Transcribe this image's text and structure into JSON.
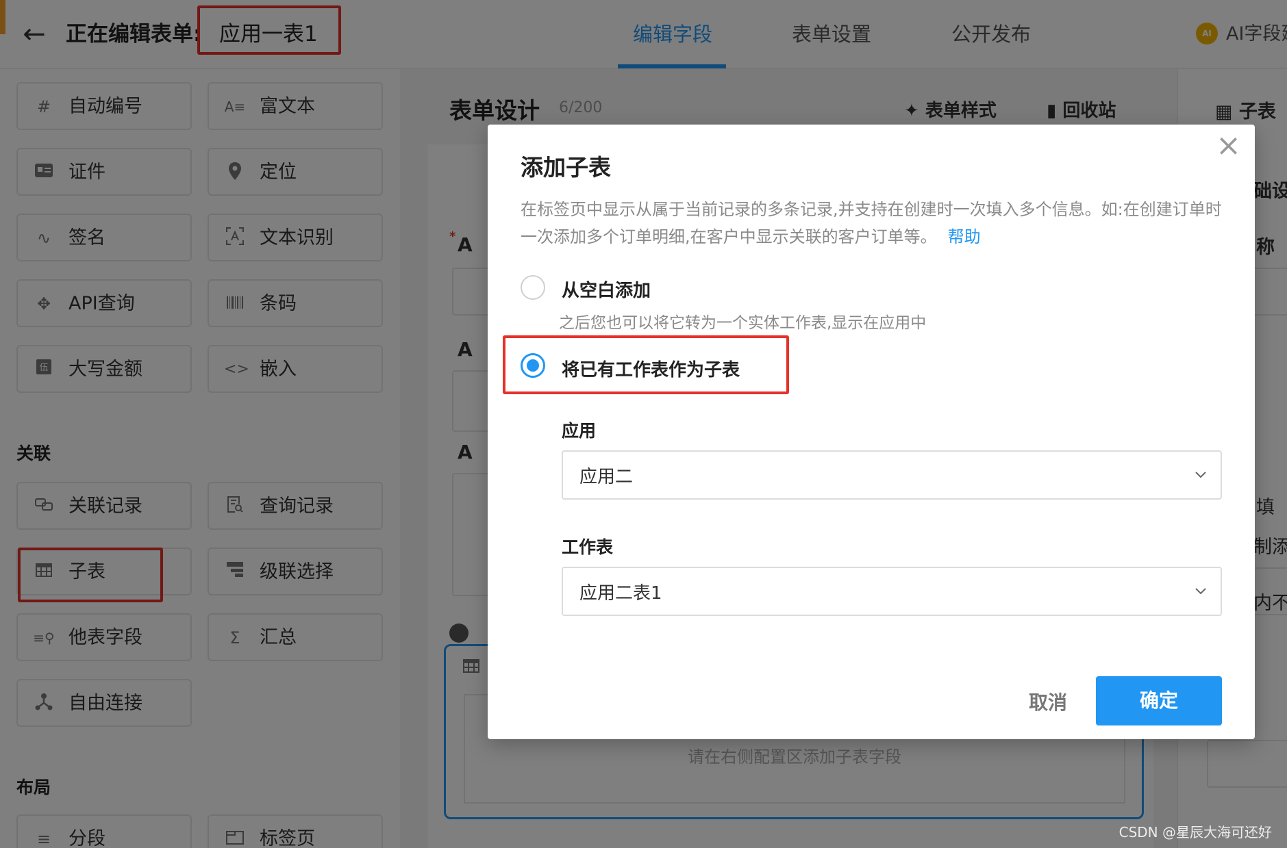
{
  "header": {
    "editing_label": "正在编辑表单:",
    "form_name": "应用一表1",
    "tabs": [
      {
        "label": "编辑字段",
        "active": true
      },
      {
        "label": "表单设置",
        "active": false
      },
      {
        "label": "公开发布",
        "active": false
      }
    ],
    "ai_label": "AI字段建"
  },
  "palette": {
    "fields": [
      {
        "label": "自动编号",
        "icon": "hash-icon"
      },
      {
        "label": "富文本",
        "icon": "rich-text-icon"
      },
      {
        "label": "证件",
        "icon": "id-card-icon"
      },
      {
        "label": "定位",
        "icon": "location-pin-icon"
      },
      {
        "label": "签名",
        "icon": "signature-icon"
      },
      {
        "label": "文本识别",
        "icon": "text-scan-icon"
      },
      {
        "label": "API查询",
        "icon": "api-icon"
      },
      {
        "label": "条码",
        "icon": "barcode-icon"
      },
      {
        "label": "大写金额",
        "icon": "currency-icon"
      },
      {
        "label": "嵌入",
        "icon": "embed-code-icon"
      }
    ],
    "relation_title": "关联",
    "relation_fields": [
      {
        "label": "关联记录",
        "icon": "link-record-icon"
      },
      {
        "label": "查询记录",
        "icon": "query-record-icon"
      },
      {
        "label": "子表",
        "icon": "table-icon"
      },
      {
        "label": "级联选择",
        "icon": "cascade-icon"
      },
      {
        "label": "他表字段",
        "icon": "other-table-field-icon"
      },
      {
        "label": "汇总",
        "icon": "sigma-icon"
      },
      {
        "label": "自由连接",
        "icon": "free-connect-icon"
      }
    ],
    "layout_title": "布局",
    "layout_fields": [
      {
        "label": "分段",
        "icon": "section-icon"
      },
      {
        "label": "标签页",
        "icon": "tab-page-icon"
      }
    ]
  },
  "design": {
    "title": "表单设计",
    "count": "6/200",
    "style_tool": "表单样式",
    "recycle_tool": "回收站",
    "required_mark": "*",
    "field_letter": "A",
    "subtable_hint": "请在右侧配置区添加子表字段"
  },
  "config": {
    "title": "子表",
    "basic_partial": "础设",
    "name_partial": "称",
    "fill_partial": "填",
    "limit_partial": "制添",
    "content_partial": "内不"
  },
  "modal": {
    "title": "添加子表",
    "description": "在标签页中显示从属于当前记录的多条记录,并支持在创建时一次填入多个信息。如:在创建订单时一次添加多个订单明细,在客户中显示关联的客户订单等。",
    "help_link": "帮助",
    "option_blank": "从空白添加",
    "option_blank_hint": "之后您也可以将它转为一个实体工作表,显示在应用中",
    "option_existing": "将已有工作表作为子表",
    "selected_option": "existing",
    "app_label": "应用",
    "app_value": "应用二",
    "sheet_label": "工作表",
    "sheet_value": "应用二表1",
    "cancel": "取消",
    "ok": "确定"
  },
  "colors": {
    "accent": "#2196f3",
    "highlight": "#e5312a"
  },
  "watermark": "CSDN @星辰大海可还好"
}
